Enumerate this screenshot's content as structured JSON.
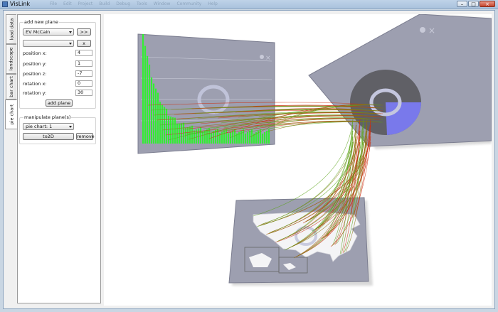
{
  "window": {
    "title": "VisLink",
    "menu": [
      "File",
      "Edit",
      "Project",
      "Build",
      "Debug",
      "Tools",
      "Window",
      "Community",
      "Help"
    ]
  },
  "tabs": [
    "load data",
    "landscape",
    "bar chart",
    "pie chart"
  ],
  "add_plane": {
    "label": "add new plane",
    "dataset_select": "EV McCain",
    "dataset_button": ">>",
    "type_select": "",
    "type_button": "x",
    "fields": [
      {
        "label": "position x:",
        "value": "4"
      },
      {
        "label": "position y:",
        "value": "1"
      },
      {
        "label": "position z:",
        "value": "-7"
      },
      {
        "label": "rotation x:",
        "value": "0"
      },
      {
        "label": "rotation y:",
        "value": "30"
      }
    ],
    "add_button": "add plane"
  },
  "manipulate": {
    "label": "manipulate plane(s)",
    "plane_select": "pie chart: 1",
    "to2d_button": "to2D",
    "remove_button": "remove"
  },
  "colors": {
    "green_bars": "#33ee33",
    "pie_highlight": "#7a7af2",
    "plane_gray": "#9d9fb0",
    "link_red": "#cc3010",
    "link_green": "#5aa418"
  }
}
